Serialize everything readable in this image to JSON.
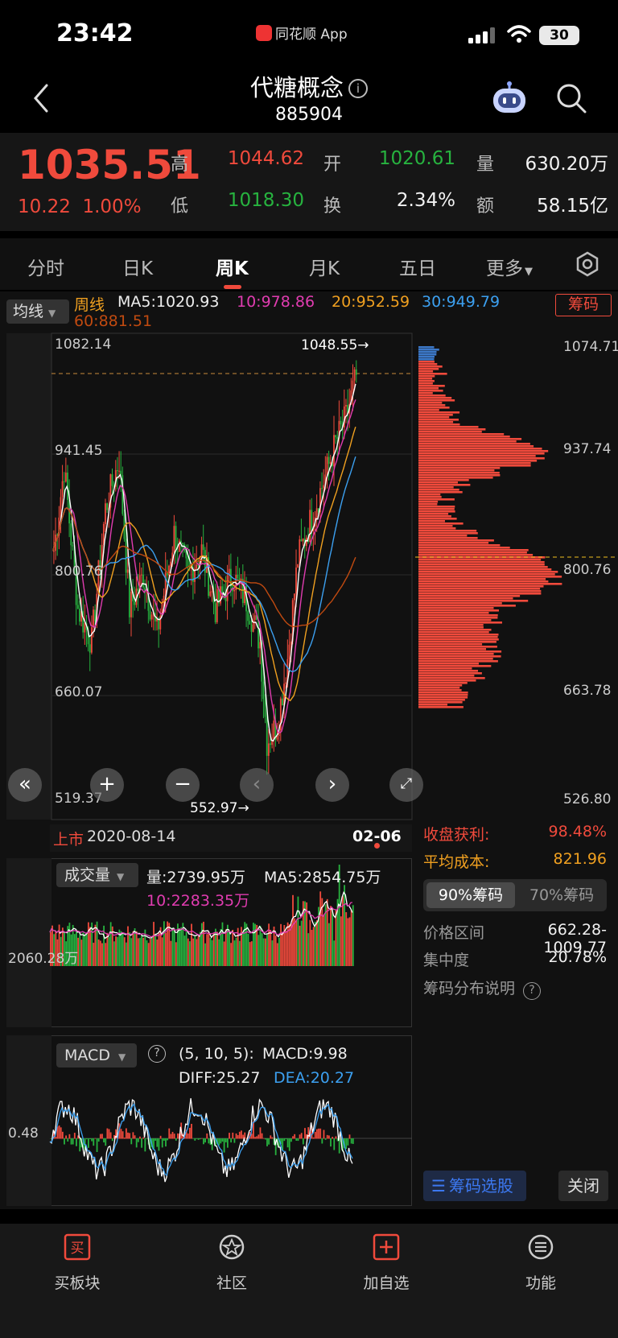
{
  "status_bar": {
    "time": "23:42",
    "app_name": "同花顺 App",
    "battery": "30"
  },
  "header": {
    "title": "代糖概念",
    "code": "885904"
  },
  "quote": {
    "price": "1035.51",
    "change": "10.22",
    "change_pct": "1.00%",
    "high_label": "高",
    "high": "1044.62",
    "low_label": "低",
    "low": "1018.30",
    "open_label": "开",
    "open": "1020.61",
    "turnover_label": "换",
    "turnover": "2.34%",
    "volume_label": "量",
    "volume": "630.20万",
    "amount_label": "额",
    "amount": "58.15亿"
  },
  "tabs": [
    {
      "label": "分时"
    },
    {
      "label": "日K"
    },
    {
      "label": "周K"
    },
    {
      "label": "月K"
    },
    {
      "label": "五日"
    },
    {
      "label": "更多"
    }
  ],
  "ma_bar": {
    "selector": "均线",
    "period": "周线",
    "ma5": "MA5:1020.93",
    "ma10": "10:978.86",
    "ma20": "20:952.59",
    "ma30": "30:949.79",
    "ma60": "60:881.51",
    "chip_button": "筹码"
  },
  "kline": {
    "y_labels": [
      "1082.14",
      "941.45",
      "800.76",
      "660.07",
      "519.37"
    ],
    "max_mark": "1048.55→",
    "min_mark": "552.97→",
    "listed_label": "上市",
    "start_date": "2020-08-14",
    "end_date": "02-06"
  },
  "chip": {
    "y_labels": [
      "1074.71",
      "937.74",
      "800.76",
      "663.78",
      "526.80"
    ],
    "profit_label": "收盘获利:",
    "profit": "98.48%",
    "avg_cost_label": "平均成本:",
    "avg_cost": "821.96",
    "toggle_90": "90%筹码",
    "toggle_70": "70%筹码",
    "range_label": "价格区间",
    "range": "662.28-1009.77",
    "concentration_label": "集中度",
    "concentration": "20.78%",
    "explain_label": "筹码分布说明",
    "select_button": "筹码选股",
    "close_button": "关闭"
  },
  "volume": {
    "selector": "成交量",
    "vol": "量:2739.95万",
    "ma5": "MA5:2854.75万",
    "ma10": "10:2283.35万",
    "axis": "2060.28万"
  },
  "macd": {
    "selector": "MACD",
    "params": "(5, 10, 5):",
    "macd": "MACD:9.98",
    "diff": "DIFF:25.27",
    "dea": "DEA:20.27",
    "axis": "0.48"
  },
  "nav": [
    {
      "label": "买板块",
      "icon": "buy-icon"
    },
    {
      "label": "社区",
      "icon": "community-icon"
    },
    {
      "label": "加自选",
      "icon": "add-watchlist-icon"
    },
    {
      "label": "功能",
      "icon": "menu-icon"
    }
  ],
  "colors": {
    "up": "#f04a3c",
    "down": "#27b33f",
    "ma5": "#ffffff",
    "ma10": "#e03cb0",
    "ma20": "#f0a020",
    "ma30": "#3ca0f0",
    "ma60": "#c04a10"
  }
}
